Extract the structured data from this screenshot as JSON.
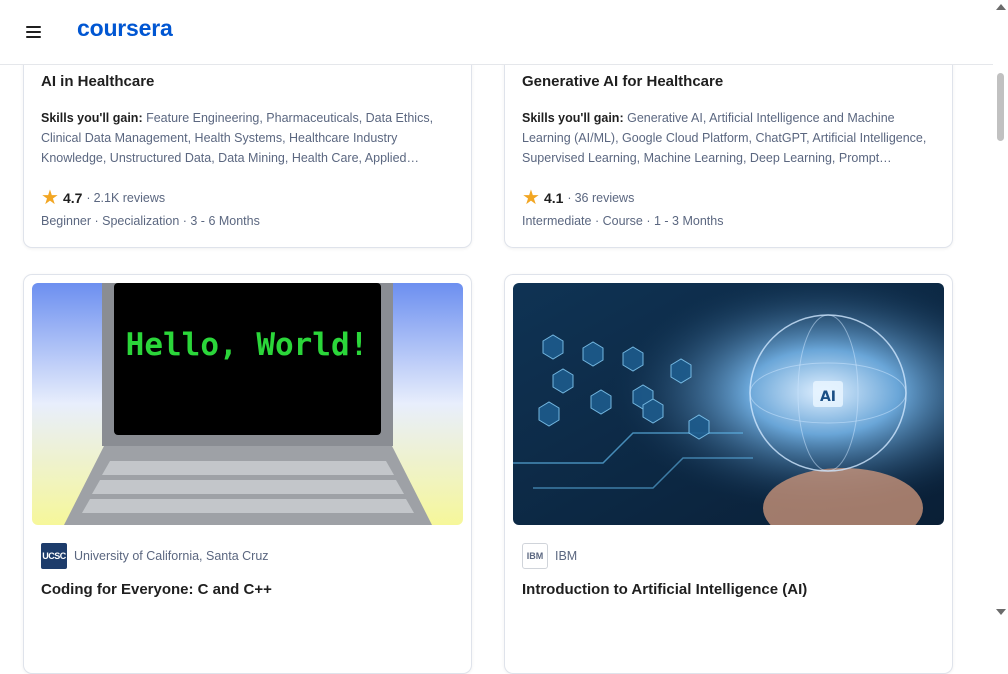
{
  "header": {
    "logo_text": "coursera",
    "brand_color": "#0056d2",
    "menu_icon": "hamburger-menu-icon"
  },
  "cards": [
    {
      "title": "AI in Healthcare",
      "skills_label": "Skills you'll gain:",
      "skills": "Feature Engineering, Pharmaceuticals, Data Ethics, Clinical Data Management, Health Systems, Healthcare Industry Knowledge, Unstructured Data, Data Mining, Health Care, Applied Machine Learning",
      "rating": "4.7",
      "rating_sep": "·",
      "reviews": "2.1K reviews",
      "meta": "Beginner · Specialization · 3 - 6 Months"
    },
    {
      "title": "Generative AI for Healthcare",
      "skills_label": "Skills you'll gain:",
      "skills": "Generative AI, Artificial Intelligence and Machine Learning (AI/ML), Google Cloud Platform, ChatGPT, Artificial Intelligence, Supervised Learning, Machine Learning, Deep Learning, Prompt Engineering",
      "rating": "4.1",
      "rating_sep": "·",
      "reviews": "36 reviews",
      "meta": "Intermediate · Course · 1 - 3 Months"
    },
    {
      "image_text": "Hello, World!",
      "partner_logo": "UCSC",
      "partner": "University of California, Santa Cruz",
      "title": "Coding for Everyone: C and C++"
    },
    {
      "image_text": "AI",
      "partner_logo": "IBM",
      "partner": "IBM",
      "title": "Introduction to Artificial Intelligence (AI)"
    }
  ],
  "colors": {
    "star": "#f2a623",
    "muted_text": "#5b6780",
    "card_border": "#dfe3eb"
  }
}
